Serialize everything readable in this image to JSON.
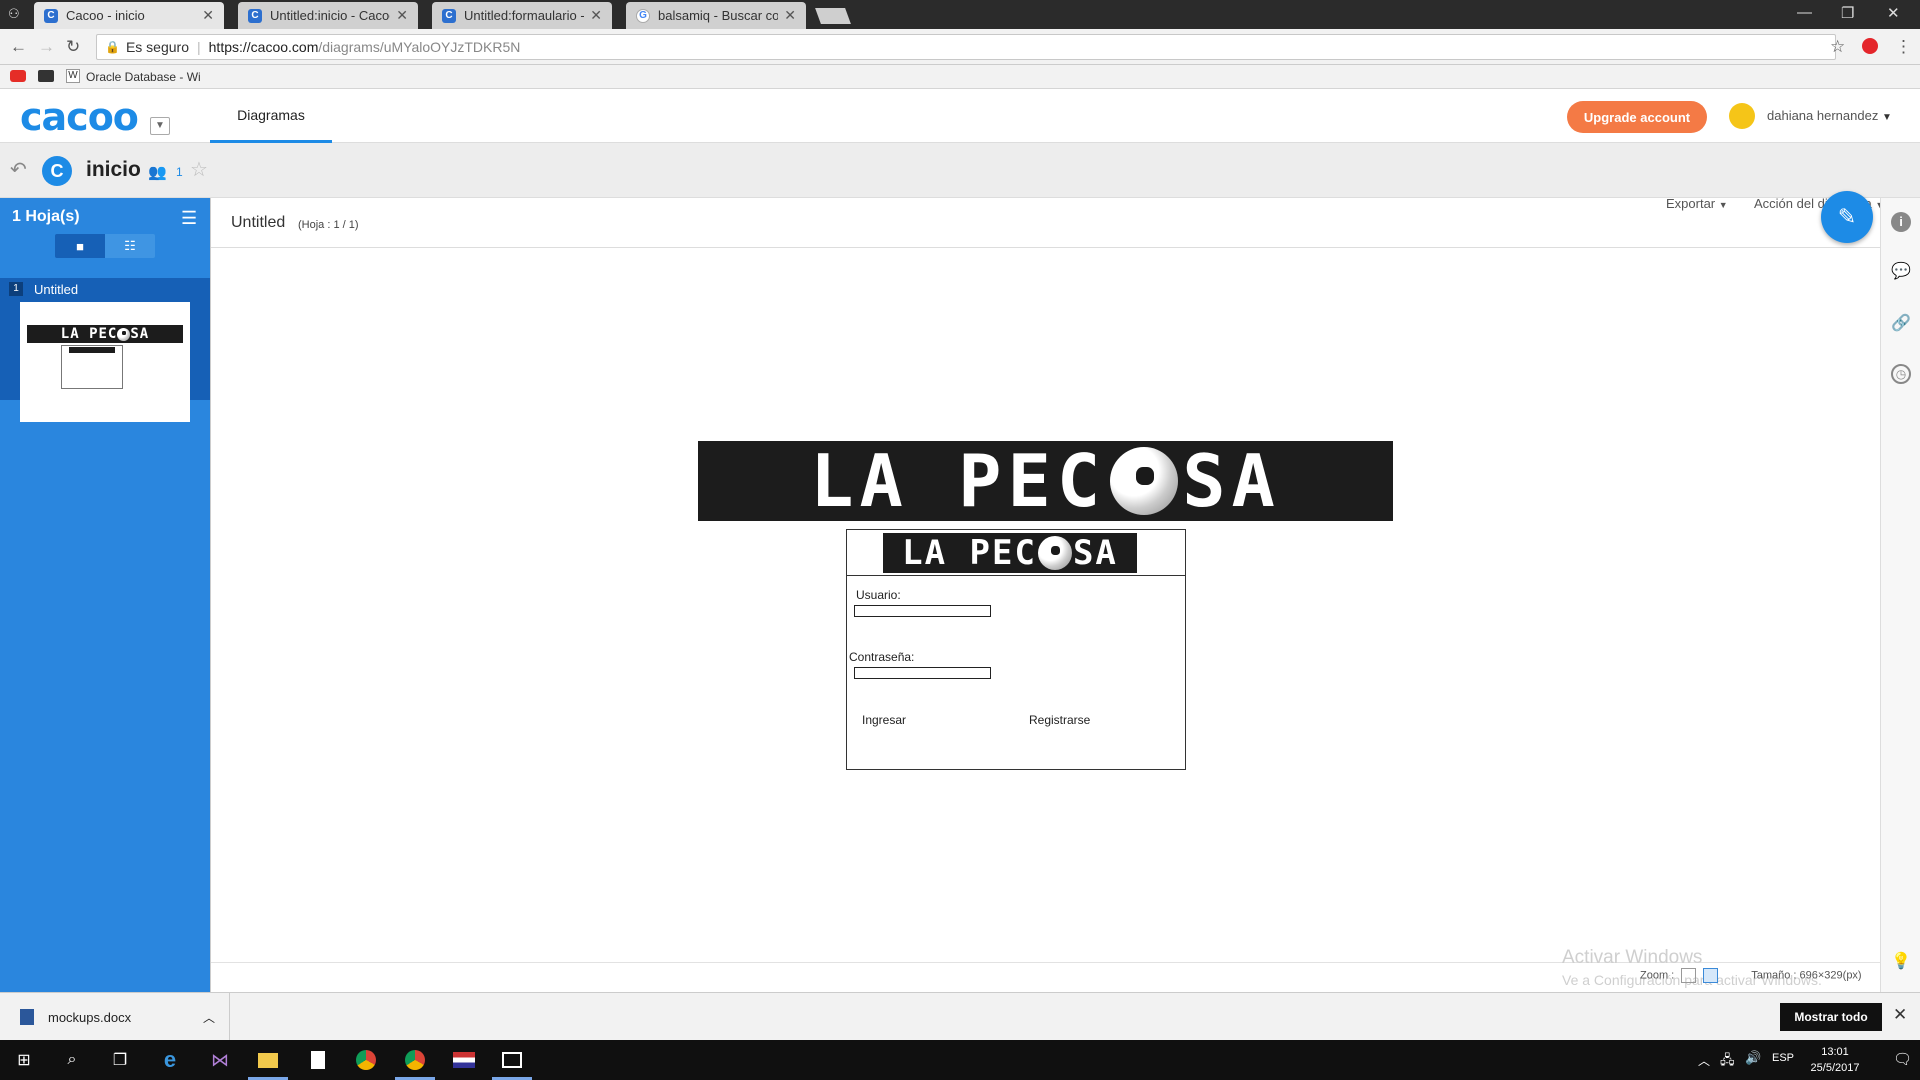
{
  "browser": {
    "tabs": [
      {
        "title": "Cacoo - inicio",
        "icon": "cacoo-favicon"
      },
      {
        "title": "Untitled:inicio - Cacoo",
        "icon": "cacoo-favicon"
      },
      {
        "title": "Untitled:formaulario - Ca",
        "icon": "cacoo-favicon"
      },
      {
        "title": "balsamiq - Buscar con G",
        "icon": "google-favicon"
      }
    ],
    "security": "Es seguro",
    "url_host": "https://cacoo.com",
    "url_path": "/diagrams/uMYaloOYJzTDKR5N",
    "bookmarks": [
      "Oracle Database - Wi"
    ]
  },
  "app": {
    "logo": "cacoo",
    "nav_tab": "Diagramas",
    "upgrade_label": "Upgrade account",
    "user_name": "dahiana hernandez",
    "accent": "#1d8be6",
    "upgrade_color": "#f47a45"
  },
  "diagram": {
    "badge": "C",
    "title": "inicio",
    "member_count": "1"
  },
  "sidebar": {
    "sheet_count": "1 Hoja(s)",
    "sheets": [
      {
        "number": "1",
        "name": "Untitled"
      }
    ]
  },
  "page": {
    "name": "Untitled",
    "count": "(Hoja : 1 / 1)",
    "export_menu": "Exportar",
    "action_menu": "Acción del diagrama"
  },
  "mockup": {
    "banner_text_left": "LA PEC",
    "banner_text_right": "SA",
    "usuario_label": "Usuario:",
    "password_label": "Contraseña:",
    "login_button": "Ingresar",
    "register_button": "Registrarse"
  },
  "statusbar": {
    "zoom_label": "Zoom :",
    "size_label": "Tamaño : 696×329(px)",
    "activation_title": "Activar Windows",
    "activation_sub": "Ve a Configuración para activar Windows."
  },
  "downloads": {
    "file": "mockups.docx",
    "show_all": "Mostrar todo"
  },
  "taskbar": {
    "lang": "ESP",
    "time": "13:01",
    "date": "25/5/2017"
  }
}
